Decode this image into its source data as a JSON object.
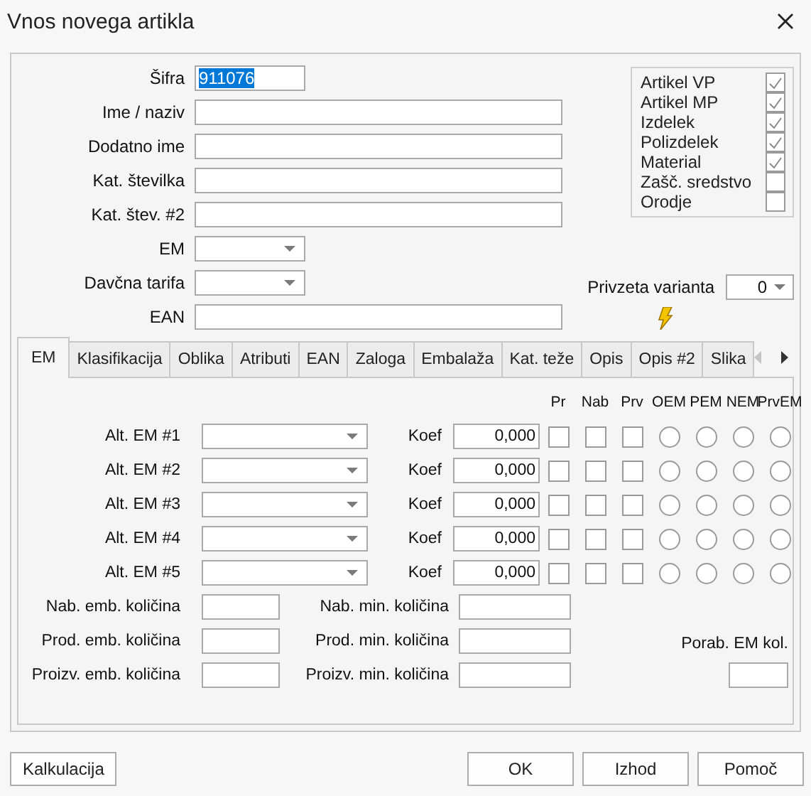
{
  "window": {
    "title": "Vnos novega artikla"
  },
  "fields": [
    {
      "label": "Šifra",
      "kind": "short",
      "value": "911076",
      "value_selected": true
    },
    {
      "label": "Ime / naziv",
      "kind": "text"
    },
    {
      "label": "Dodatno ime",
      "kind": "text"
    },
    {
      "label": "Kat. številka",
      "kind": "text"
    },
    {
      "label": "Kat. štev. #2",
      "kind": "text"
    },
    {
      "label": "EM",
      "kind": "combo"
    },
    {
      "label": "Davčna tarifa",
      "kind": "combo"
    },
    {
      "label": "EAN",
      "kind": "text"
    }
  ],
  "flags": [
    {
      "label": "Artikel VP",
      "checked": true
    },
    {
      "label": "Artikel MP",
      "checked": true
    },
    {
      "label": "Izdelek",
      "checked": true
    },
    {
      "label": "Polizdelek",
      "checked": true
    },
    {
      "label": "Material",
      "checked": true
    },
    {
      "label": "Zašč. sredstvo",
      "checked": false
    },
    {
      "label": "Orodje",
      "checked": false
    }
  ],
  "default_variant": {
    "label": "Privzeta varianta",
    "value": "0"
  },
  "tabs": [
    {
      "label": "EM",
      "selected": true
    },
    {
      "label": "Klasifikacija",
      "selected": false
    },
    {
      "label": "Oblika",
      "selected": false
    },
    {
      "label": "Atributi",
      "selected": false
    },
    {
      "label": "EAN",
      "selected": false
    },
    {
      "label": "Zaloga",
      "selected": false
    },
    {
      "label": "Embalaža",
      "selected": false
    },
    {
      "label": "Kat. teže",
      "selected": false
    },
    {
      "label": "Opis",
      "selected": false
    },
    {
      "label": "Opis #2",
      "selected": false
    },
    {
      "label": "Slika",
      "selected": false
    }
  ],
  "columns": [
    {
      "label": "Pr",
      "kind": "check"
    },
    {
      "label": "Nab",
      "kind": "check"
    },
    {
      "label": "Prv",
      "kind": "check"
    },
    {
      "label": "OEM",
      "kind": "radio"
    },
    {
      "label": "PEM",
      "kind": "radio"
    },
    {
      "label": "NEM",
      "kind": "radio"
    },
    {
      "label": "PrvEM",
      "kind": "radio"
    }
  ],
  "alt_units": [
    {
      "label": "Alt. EM #1",
      "koef_label": "Koef",
      "koef": "0,000",
      "values": [
        false,
        false,
        false,
        false,
        false,
        false,
        false
      ]
    },
    {
      "label": "Alt. EM #2",
      "koef_label": "Koef",
      "koef": "0,000",
      "values": [
        false,
        false,
        false,
        false,
        false,
        false,
        false
      ]
    },
    {
      "label": "Alt. EM #3",
      "koef_label": "Koef",
      "koef": "0,000",
      "values": [
        false,
        false,
        false,
        false,
        false,
        false,
        false
      ]
    },
    {
      "label": "Alt. EM #4",
      "koef_label": "Koef",
      "koef": "0,000",
      "values": [
        false,
        false,
        false,
        false,
        false,
        false,
        false
      ]
    },
    {
      "label": "Alt. EM #5",
      "koef_label": "Koef",
      "koef": "0,000",
      "values": [
        false,
        false,
        false,
        false,
        false,
        false,
        false
      ]
    }
  ],
  "quantities": [
    {
      "emb_label": "Nab. emb. količina",
      "min_label": "Nab. min. količina"
    },
    {
      "emb_label": "Prod. emb. količina",
      "min_label": "Prod. min. količina"
    },
    {
      "emb_label": "Proizv. emb. količina",
      "min_label": "Proizv. min. količina"
    }
  ],
  "porab": {
    "label": "Porab. EM kol."
  },
  "buttons": {
    "left": [
      "Kalkulacija"
    ],
    "right": [
      "OK",
      "Izhod",
      "Pomoč"
    ]
  }
}
